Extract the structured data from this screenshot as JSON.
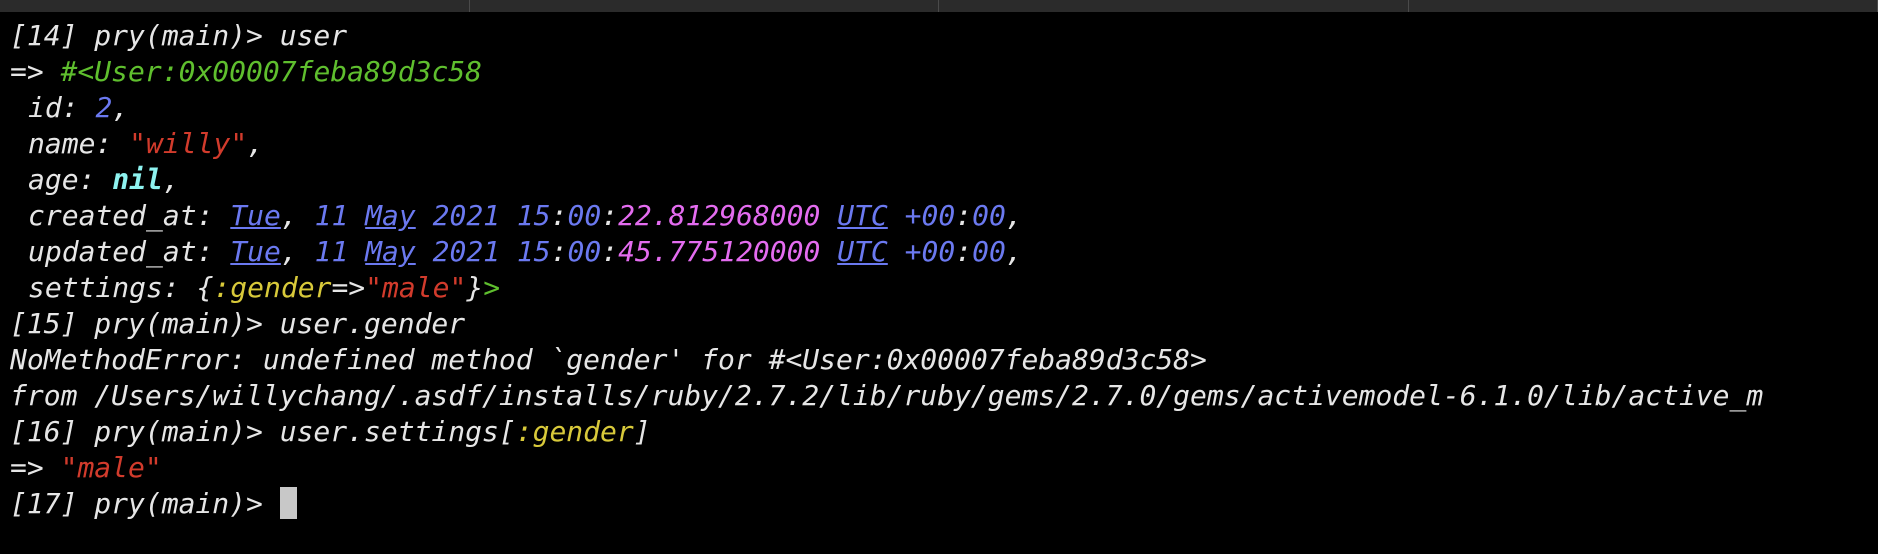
{
  "terminal": {
    "lines": {
      "l0": {
        "prompt": "[14] pry(main)> ",
        "input": "user"
      },
      "l1": {
        "arrow": "=> ",
        "value": "#<User:0x00007feba89d3c58"
      },
      "l2": {
        "key": "id: ",
        "value": "2",
        "suffix": ","
      },
      "l3": {
        "key": "name: ",
        "q1": "\"",
        "value": "willy",
        "q2": "\"",
        "suffix": ","
      },
      "l4": {
        "key": "age: ",
        "value": "nil",
        "suffix": ","
      },
      "l5": {
        "key": "created_at: ",
        "day": "Tue",
        "comma": ", ",
        "date": "11",
        "sp1": " ",
        "month": "May",
        "sp2": " ",
        "year": "2021",
        "sp3": " ",
        "hour": "15",
        "c1": ":",
        "minute": "00",
        "c2": ":",
        "seconds": "22.812968000",
        "sp4": " ",
        "tz": "UTC",
        "sp5": " ",
        "offset_h": "+00",
        "c3": ":",
        "offset_m": "00",
        "suffix": ","
      },
      "l6": {
        "key": "updated_at: ",
        "day": "Tue",
        "comma": ", ",
        "date": "11",
        "sp1": " ",
        "month": "May",
        "sp2": " ",
        "year": "2021",
        "sp3": " ",
        "hour": "15",
        "c1": ":",
        "minute": "00",
        "c2": ":",
        "seconds": "45.775120000",
        "sp4": " ",
        "tz": "UTC",
        "sp5": " ",
        "offset_h": "+00",
        "c3": ":",
        "offset_m": "00",
        "suffix": ","
      },
      "l7": {
        "key": "settings: ",
        "open": "{",
        "symbol": ":gender",
        "rocket": "=>",
        "q1": "\"",
        "value": "male",
        "q2": "\"",
        "close": "}",
        "gt": ">"
      },
      "l8": {
        "prompt": "[15] pry(main)> ",
        "input": "user.gender"
      },
      "l9": {
        "text": "NoMethodError: undefined method `gender' for #<User:0x00007feba89d3c58>"
      },
      "l10": {
        "text": "from /Users/willychang/.asdf/installs/ruby/2.7.2/lib/ruby/gems/2.7.0/gems/activemodel-6.1.0/lib/active_m"
      },
      "l11": {
        "prompt": "[16] pry(main)> ",
        "input_a": "user.settings[",
        "symbol": ":gender",
        "input_b": "]"
      },
      "l12": {
        "arrow": "=> ",
        "q1": "\"",
        "value": "male",
        "q2": "\""
      },
      "l13": {
        "prompt": "[17] pry(main)> "
      }
    }
  },
  "colors": {
    "background": "#000000",
    "foreground": "#e6e6e6",
    "green": "#5fbf2e",
    "blue": "#6b79f0",
    "red": "#d23b2c",
    "cyan": "#8ef3f0",
    "yellow": "#d8c93a",
    "magenta": "#e46cf0"
  }
}
